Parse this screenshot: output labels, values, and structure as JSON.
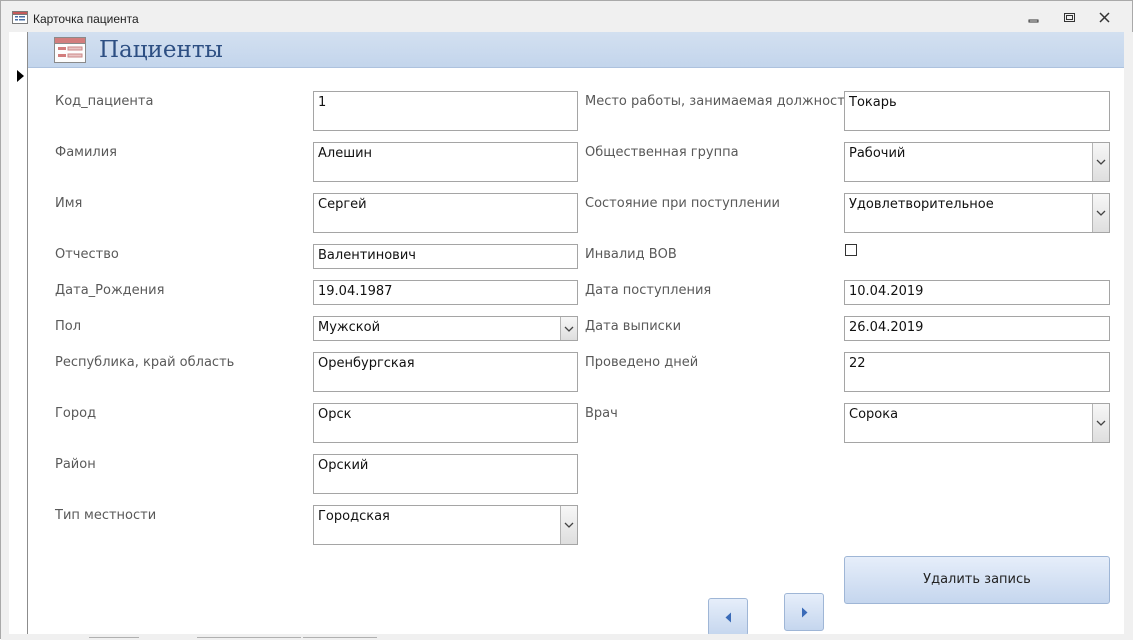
{
  "window": {
    "title": "Карточка пациента"
  },
  "header": {
    "title": "Пациенты"
  },
  "left_fields": [
    {
      "label": "Код_пациента",
      "value": "1",
      "type": "text"
    },
    {
      "label": "Фамилия",
      "value": "Алешин",
      "type": "text"
    },
    {
      "label": "Имя",
      "value": "Сергей",
      "type": "text"
    },
    {
      "label": "Отчество",
      "value": "Валентинович",
      "type": "text"
    },
    {
      "label": "Дата_Рождения",
      "value": "19.04.1987",
      "type": "text"
    },
    {
      "label": "Пол",
      "value": "Мужской",
      "type": "combo"
    },
    {
      "label": "Республика, край область",
      "value": "Оренбургская",
      "type": "text"
    },
    {
      "label": "Город",
      "value": "Орск",
      "type": "text"
    },
    {
      "label": "Район",
      "value": "Орский",
      "type": "text"
    },
    {
      "label": "Тип местности",
      "value": "Городская",
      "type": "combo"
    }
  ],
  "right_fields": [
    {
      "label": "Место работы, занимаемая должность",
      "value": "Токарь",
      "type": "text"
    },
    {
      "label": "Общественная группа",
      "value": "Рабочий",
      "type": "combo"
    },
    {
      "label": "Состояние при поступлении",
      "value": "Удовлетворительное",
      "type": "combo"
    },
    {
      "label": "Инвалид ВОВ",
      "checked": false,
      "type": "checkbox"
    },
    {
      "label": "Дата поступления",
      "value": "10.04.2019",
      "type": "text"
    },
    {
      "label": "Дата выписки",
      "value": "26.04.2019",
      "type": "text"
    },
    {
      "label": "Проведено дней",
      "value": "22",
      "type": "text"
    },
    {
      "label": "Врач",
      "value": "Сорока",
      "type": "combo"
    }
  ],
  "buttons": {
    "delete_label": "Удалить запись"
  },
  "icons": {
    "window_icon": "form-icon",
    "minimize": "minimize-icon",
    "restore": "restore-icon",
    "close": "close-icon",
    "prev": "arrow-left-icon",
    "next": "arrow-right-icon",
    "dropdown": "chevron-down-icon"
  },
  "colors": {
    "header_bg": "#c8d9ee",
    "title_text": "#2d4f83",
    "button_bg": "#d3e0f2"
  }
}
